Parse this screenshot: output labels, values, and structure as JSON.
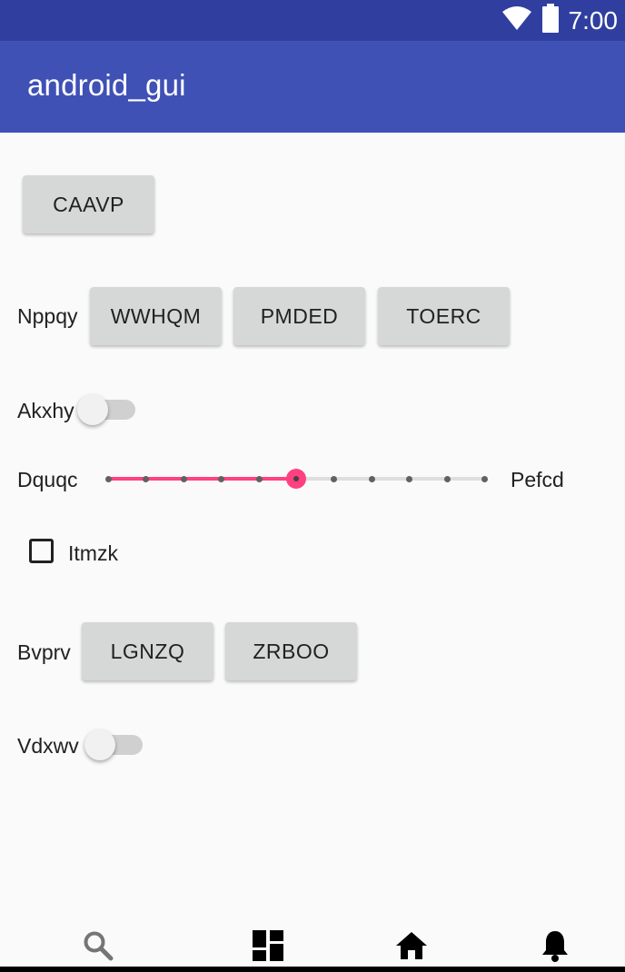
{
  "status_bar": {
    "time": "7:00",
    "wifi_icon": "wifi-icon",
    "battery_icon": "battery-icon"
  },
  "app_bar": {
    "title": "android_gui"
  },
  "colors": {
    "primary": "#3f51b5",
    "primary_dark": "#303f9f",
    "accent": "#ff4081"
  },
  "buttons": {
    "caavp": "CAAVP"
  },
  "row_nppqy": {
    "label": "Nppqy",
    "buttons": [
      "WWHQM",
      "PMDED",
      "TOERC"
    ]
  },
  "switch_akxhy": {
    "label": "Akxhy",
    "checked": false
  },
  "slider": {
    "left_label": "Dquqc",
    "right_label": "Pefcd",
    "min": 0,
    "max": 10,
    "value": 5,
    "ticks": 11
  },
  "checkbox": {
    "label": "Itmzk",
    "checked": false
  },
  "row_bvprv": {
    "label": "Bvprv",
    "buttons": [
      "LGNZQ",
      "ZRBOO"
    ]
  },
  "switch_vdxwv": {
    "label": "Vdxwv",
    "checked": false
  },
  "bottom_nav": [
    {
      "icon": "search-icon"
    },
    {
      "icon": "dashboard-icon"
    },
    {
      "icon": "home-icon"
    },
    {
      "icon": "notifications-icon"
    }
  ]
}
